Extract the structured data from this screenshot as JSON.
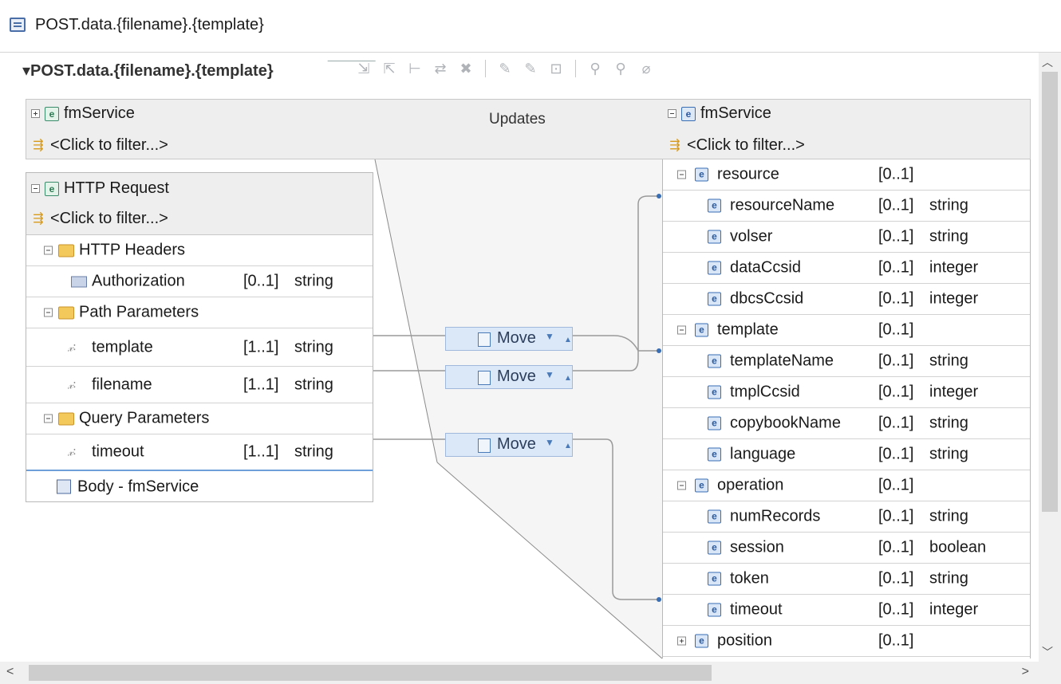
{
  "window": {
    "title": "POST.data.{filename}.{template}"
  },
  "editor": {
    "title": "POST.data.{filename}.{template}",
    "toolbar_icons": [
      "add-input-icon",
      "add-output-icon",
      "connect-icon",
      "move-icon",
      "delete-icon",
      "edit-icon",
      "edit-icon-2",
      "sort-icon",
      "filter-icon",
      "filter-icon-2",
      "clear-filter-icon"
    ]
  },
  "top_band": {
    "source_service": "fmService",
    "source_filter": "<Click to filter...>",
    "label": "Updates",
    "target_service": "fmService",
    "target_filter": "<Click to filter...>"
  },
  "left_panel": {
    "title": "HTTP Request",
    "filter": "<Click to filter...>",
    "groups": {
      "headers": "HTTP Headers",
      "path": "Path Parameters",
      "query": "Query Parameters"
    },
    "fields": {
      "authorization": {
        "name": "Authorization",
        "card": "[0..1]",
        "type": "string"
      },
      "template": {
        "name": "template",
        "card": "[1..1]",
        "type": "string"
      },
      "filename": {
        "name": "filename",
        "card": "[1..1]",
        "type": "string"
      },
      "timeout": {
        "name": "timeout",
        "card": "[1..1]",
        "type": "string"
      }
    },
    "body": "Body - fmService"
  },
  "transforms": {
    "move_label": "Move"
  },
  "right_panel": {
    "rows": [
      {
        "name": "resource",
        "card": "[0..1]",
        "type": "",
        "level": 0,
        "expander": "minus"
      },
      {
        "name": "resourceName",
        "card": "[0..1]",
        "type": "string",
        "level": 1
      },
      {
        "name": "volser",
        "card": "[0..1]",
        "type": "string",
        "level": 1
      },
      {
        "name": "dataCcsid",
        "card": "[0..1]",
        "type": "integer",
        "level": 1
      },
      {
        "name": "dbcsCcsid",
        "card": "[0..1]",
        "type": "integer",
        "level": 1
      },
      {
        "name": "template",
        "card": "[0..1]",
        "type": "",
        "level": 0,
        "expander": "minus"
      },
      {
        "name": "templateName",
        "card": "[0..1]",
        "type": "string",
        "level": 1
      },
      {
        "name": "tmplCcsid",
        "card": "[0..1]",
        "type": "integer",
        "level": 1
      },
      {
        "name": "copybookName",
        "card": "[0..1]",
        "type": "string",
        "level": 1
      },
      {
        "name": "language",
        "card": "[0..1]",
        "type": "string",
        "level": 1
      },
      {
        "name": "operation",
        "card": "[0..1]",
        "type": "",
        "level": 0,
        "expander": "minus"
      },
      {
        "name": "numRecords",
        "card": "[0..1]",
        "type": "string",
        "level": 1
      },
      {
        "name": "session",
        "card": "[0..1]",
        "type": "boolean",
        "level": 1
      },
      {
        "name": "token",
        "card": "[0..1]",
        "type": "string",
        "level": 1
      },
      {
        "name": "timeout",
        "card": "[0..1]",
        "type": "integer",
        "level": 1
      },
      {
        "name": "position",
        "card": "[0..1]",
        "type": "",
        "level": 0,
        "expander": "plus"
      }
    ]
  },
  "colors": {
    "panel_bg": "#eeeeee",
    "move_bg": "#dbe8f8",
    "wire": "#9a9a9a",
    "accent": "#3a6eb4"
  }
}
